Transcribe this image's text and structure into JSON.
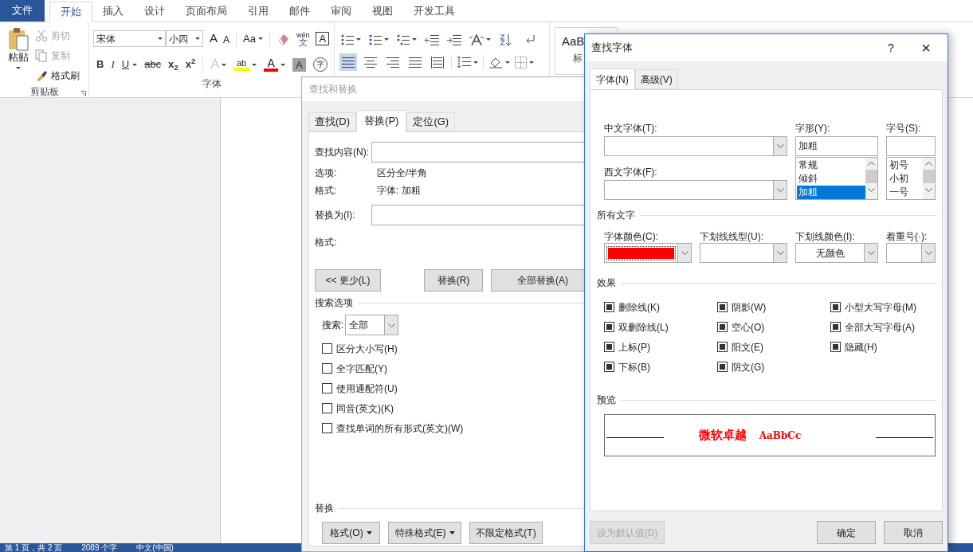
{
  "ribbon": {
    "tabs": [
      {
        "label": "文件",
        "kind": "file",
        "selected": false
      },
      {
        "label": "开始",
        "kind": "tab",
        "selected": true
      },
      {
        "label": "插入",
        "kind": "tab",
        "selected": false
      },
      {
        "label": "设计",
        "kind": "tab",
        "selected": false
      },
      {
        "label": "页面布局",
        "kind": "tab",
        "selected": false
      },
      {
        "label": "引用",
        "kind": "tab",
        "selected": false
      },
      {
        "label": "邮件",
        "kind": "tab",
        "selected": false
      },
      {
        "label": "审阅",
        "kind": "tab",
        "selected": false
      },
      {
        "label": "视图",
        "kind": "tab",
        "selected": false
      },
      {
        "label": "开发工具",
        "kind": "tab",
        "selected": false
      }
    ],
    "clipboard": {
      "paste": "粘贴",
      "items": [
        {
          "label": "剪切",
          "kind": "cut",
          "disabled": true
        },
        {
          "label": "复制",
          "kind": "copy",
          "disabled": true
        },
        {
          "label": "格式刷",
          "kind": "brush",
          "disabled": false
        }
      ],
      "group_label": "剪贴板"
    },
    "font": {
      "font_name": "宋体",
      "font_size": "小四",
      "grow": "A",
      "shrink": "A",
      "change_case": "Aa",
      "phonetic_top": "wén",
      "phonetic_bottom": "文",
      "border_char": "A",
      "format_buttons": [
        {
          "text": "B",
          "kind": "bold"
        },
        {
          "text": "I",
          "kind": "italic"
        },
        {
          "text": "U",
          "kind": "underline"
        },
        {
          "text": "abc",
          "kind": "strike"
        },
        {
          "text": "x$_{2}$",
          "kind": "sub"
        },
        {
          "text": "x$^{2}$",
          "kind": "sup"
        }
      ],
      "text_effect": {
        "text": "A",
        "disabled": true
      },
      "highlight": {
        "text": "ab",
        "color": "#ffff00"
      },
      "font_color": {
        "text": "A",
        "color": "#ff0000"
      },
      "shading": "A",
      "enclose": "字",
      "group_label": "字体"
    },
    "paragraph": {
      "align": [
        {
          "kind": "left",
          "selected": true
        },
        {
          "kind": "center",
          "selected": false
        },
        {
          "kind": "right",
          "selected": false
        },
        {
          "kind": "justify",
          "selected": false
        },
        {
          "kind": "distributed",
          "selected": false
        }
      ]
    },
    "styles": {
      "preview": "AaB",
      "caption": "标"
    }
  },
  "status_bar": [
    "第 1 页，共 2 页",
    "2089 个字",
    "中文(中国)"
  ],
  "find_replace": {
    "title": "查找和替换",
    "active": false,
    "tabs": [
      {
        "label": "查找(D)",
        "selected": false
      },
      {
        "label": "替换(P)",
        "selected": true
      },
      {
        "label": "定位(G)",
        "selected": false
      }
    ],
    "find_label": "查找内容(N):",
    "options_label": "选项:",
    "options_value": "区分全/半角",
    "format_label": "格式:",
    "format_value": "字体: 加粗",
    "replace_label": "替换为(I):",
    "replace_format_label": "格式:",
    "buttons": [
      "<< 更少(L)",
      "替换(R)",
      "全部替换(A)"
    ],
    "search_options_title": "搜索选项",
    "search_label": "搜索:",
    "search_value": "全部",
    "checkboxes": [
      {
        "label": "区分大小写(H)",
        "checked": false
      },
      {
        "label": "全字匹配(Y)",
        "checked": false
      },
      {
        "label": "使用通配符(U)",
        "checked": false
      },
      {
        "label": "同音(英文)(K)",
        "checked": false
      },
      {
        "label": "查找单词的所有形式(英文)(W)",
        "checked": false
      }
    ],
    "replace_section_title": "替换",
    "bottom_buttons": [
      {
        "label": "格式(O)",
        "dropdown": true
      },
      {
        "label": "特殊格式(E)",
        "dropdown": true
      },
      {
        "label": "不限定格式(T)",
        "dropdown": false
      }
    ]
  },
  "find_font": {
    "title": "查找字体",
    "help": "?",
    "close": "×",
    "tabs": [
      {
        "label": "字体(N)",
        "selected": true
      },
      {
        "label": "高级(V)",
        "selected": false
      }
    ],
    "chinese_font_label": "中文字体(T):",
    "western_font_label": "西文字体(F):",
    "style_label": "字形(Y):",
    "style_value": "加粗",
    "style_list": [
      {
        "label": "常规",
        "selected": false
      },
      {
        "label": "倾斜",
        "selected": false
      },
      {
        "label": "加粗",
        "selected": true
      }
    ],
    "size_label": "字号(S):",
    "size_list": [
      {
        "label": "初号",
        "selected": false
      },
      {
        "label": "小初",
        "selected": false
      },
      {
        "label": "一号",
        "selected": false
      }
    ],
    "all_text_title": "所有文字",
    "font_color_label": "字体颜色(C):",
    "font_color_swatch": {
      "color": "#ff0000"
    },
    "underline_style_label": "下划线线型(U):",
    "underline_color_label": "下划线颜色(I):",
    "underline_color_value": "无颜色",
    "emphasis_label": "着重号(·):",
    "effects_title": "效果",
    "effects": [
      {
        "label": "删除线(K)",
        "indeterminate": true
      },
      {
        "label": "阴影(W)",
        "indeterminate": true
      },
      {
        "label": "小型大写字母(M)",
        "indeterminate": true
      },
      {
        "label": "双删除线(L)",
        "indeterminate": true
      },
      {
        "label": "空心(O)",
        "indeterminate": true
      },
      {
        "label": "全部大写字母(A)",
        "indeterminate": true
      },
      {
        "label": "上标(P)",
        "indeterminate": true
      },
      {
        "label": "阳文(E)",
        "indeterminate": true
      },
      {
        "label": "隐藏(H)",
        "indeterminate": true
      },
      {
        "label": "下标(B)",
        "indeterminate": true
      },
      {
        "label": "阴文(G)",
        "indeterminate": true
      }
    ],
    "preview_title": "预览",
    "preview_cjk": "微软卓越",
    "preview_latin": "AaBbCc",
    "buttons": [
      {
        "label": "设为默认值(D)",
        "disabled": true
      },
      {
        "label": "确定",
        "disabled": false
      },
      {
        "label": "取消",
        "disabled": false
      }
    ]
  }
}
